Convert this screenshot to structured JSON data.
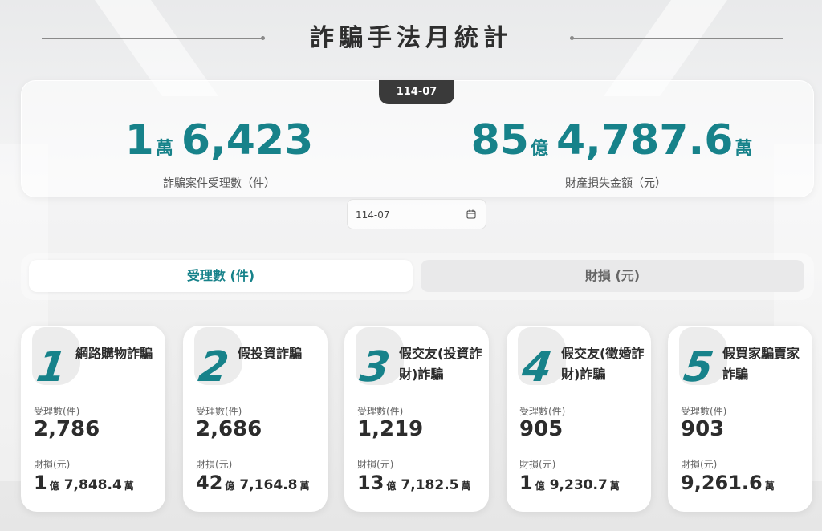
{
  "title": "詐騙手法月統計",
  "period_badge": "114-07",
  "summary": {
    "cases": {
      "part1": "1",
      "unit1": "萬",
      "part2": "6,423",
      "label": "詐騙案件受理數（件）"
    },
    "loss": {
      "part1": "85",
      "unit1": "億",
      "part2": "4,787.6",
      "unit2": "萬",
      "label": "財產損失金額（元）"
    }
  },
  "date_input": {
    "value": "114-07",
    "icon": "calendar-icon"
  },
  "tabs": [
    {
      "label": "受理數 (件)",
      "active": true
    },
    {
      "label": "財損 (元)",
      "active": false
    }
  ],
  "card_labels": {
    "count": "受理數(件)",
    "loss": "財損(元)"
  },
  "cards": [
    {
      "rank": "1",
      "name": "網路購物詐騙",
      "count": "2,786",
      "loss_n1": "1",
      "loss_u1": "億",
      "loss_n2": "7,848.4",
      "loss_u2": "萬"
    },
    {
      "rank": "2",
      "name": "假投資詐騙",
      "count": "2,686",
      "loss_n1": "42",
      "loss_u1": "億",
      "loss_n2": "7,164.8",
      "loss_u2": "萬"
    },
    {
      "rank": "3",
      "name": "假交友(投資詐財)詐騙",
      "count": "1,219",
      "loss_n1": "13",
      "loss_u1": "億",
      "loss_n2": "7,182.5",
      "loss_u2": "萬"
    },
    {
      "rank": "4",
      "name": "假交友(徵婚詐財)詐騙",
      "count": "905",
      "loss_n1": "1",
      "loss_u1": "億",
      "loss_n2": "9,230.7",
      "loss_u2": "萬"
    },
    {
      "rank": "5",
      "name": "假買家騙賣家詐騙",
      "count": "903",
      "loss_n1": "9,261.6",
      "loss_u1": "萬",
      "loss_n2": "",
      "loss_u2": ""
    }
  ],
  "colors": {
    "accent": "#17828a",
    "badge": "#3a3a3a"
  }
}
